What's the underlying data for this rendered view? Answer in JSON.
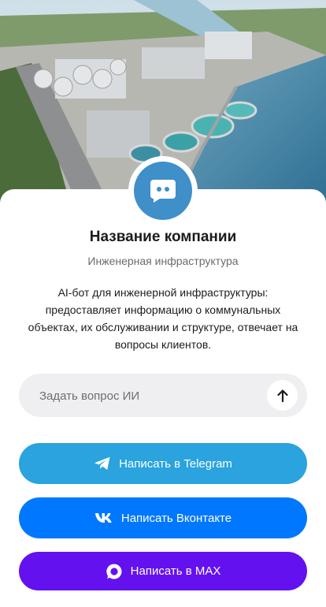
{
  "company": {
    "name": "Название компании",
    "subtitle": "Инженерная инфраструктура",
    "description": "AI-бот для инженерной инфраструктуры: предоставляет информацию о коммунальных объектах, их обслуживании и структуре, отвечает на вопросы клиентов."
  },
  "ask": {
    "placeholder": "Задать вопрос ИИ",
    "value": ""
  },
  "buttons": {
    "telegram": {
      "label": "Написать в Telegram",
      "color": "#2aa3de"
    },
    "vk": {
      "label": "Написать Вконтакте",
      "color": "#0077ff"
    },
    "max": {
      "label": "Написать в MAX",
      "color": "#6411f0"
    }
  },
  "icons": {
    "avatar": "chat-bubble-icon",
    "send": "arrow-up-icon",
    "telegram": "telegram-icon",
    "vk": "vk-icon",
    "max": "max-icon"
  }
}
